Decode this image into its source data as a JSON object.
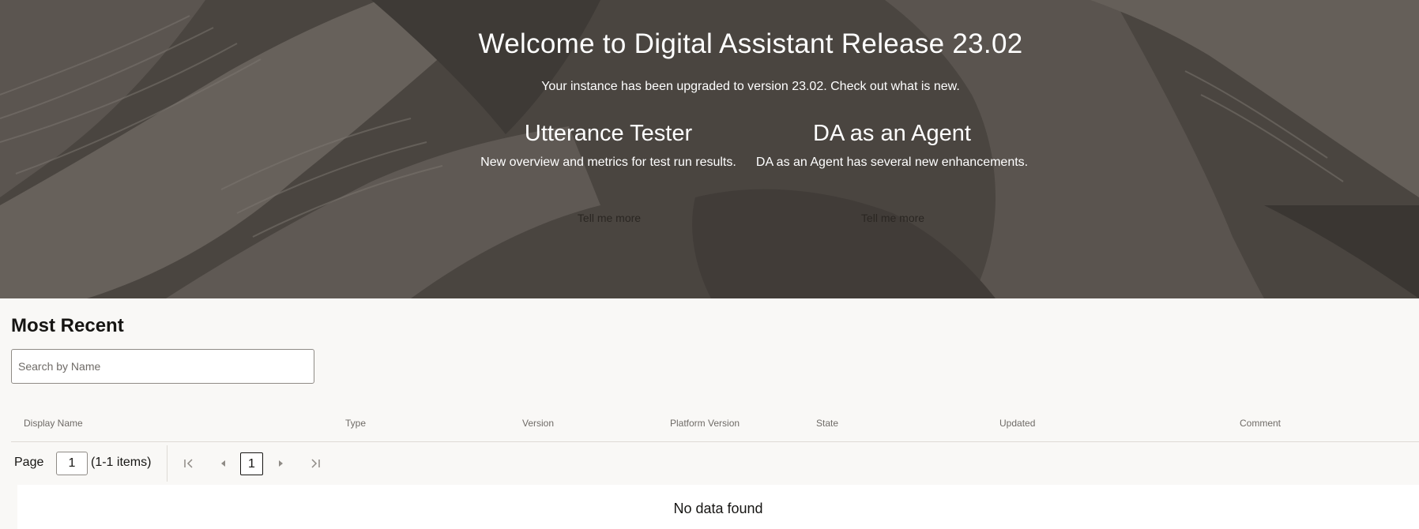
{
  "hero": {
    "title": "Welcome to Digital Assistant Release 23.02",
    "subtitle": "Your instance has been upgraded to version 23.02. Check out what is new.",
    "features": [
      {
        "title": "Utterance Tester",
        "description": "New overview and metrics for test run results.",
        "button_label": "Tell me more"
      },
      {
        "title": "DA as an Agent",
        "description": "DA as an Agent has several new enhancements.",
        "button_label": "Tell me more"
      }
    ]
  },
  "recent": {
    "title": "Most Recent",
    "search": {
      "placeholder": "Search by Name",
      "value": ""
    },
    "columns": [
      "Display Name",
      "Type",
      "Version",
      "Platform Version",
      "State",
      "Updated",
      "Comment"
    ],
    "empty_message": "No data found"
  },
  "pagination": {
    "page_label": "Page",
    "page_value": "1",
    "items_summary": "(1-1 items)",
    "current_page": "1",
    "icons": [
      "first-page-icon",
      "previous-page-icon",
      "next-page-icon",
      "last-page-icon"
    ]
  },
  "colors": {
    "hero_background": "#4a4540",
    "page_background": "#f9f8f6",
    "text_primary": "#161513",
    "text_secondary": "#6f6b67"
  }
}
